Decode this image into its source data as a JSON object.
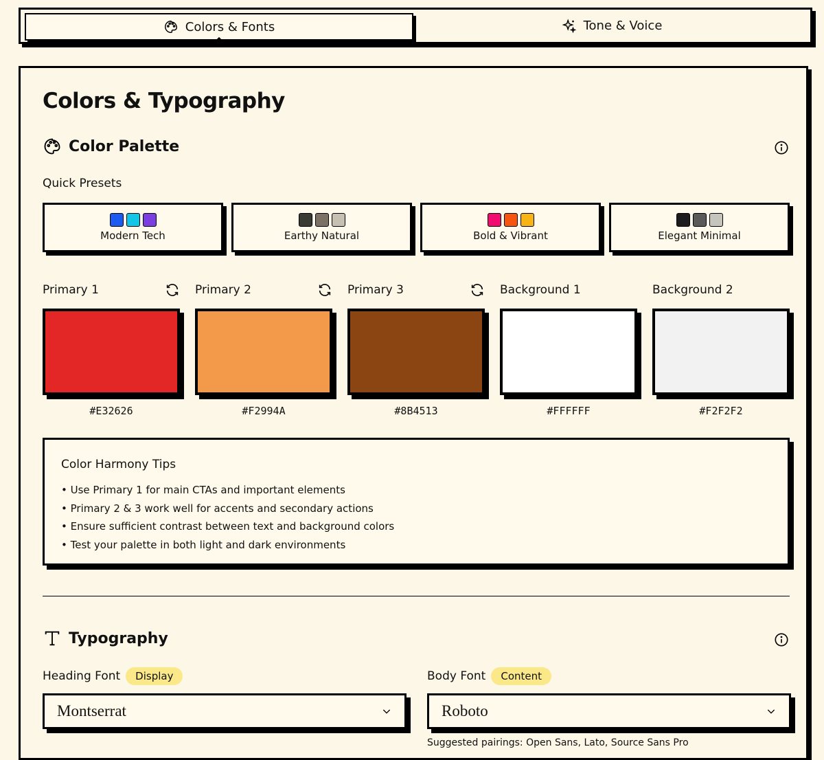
{
  "tabs": [
    {
      "label": "Colors & Fonts",
      "icon": "palette-icon",
      "active": true
    },
    {
      "label": "Tone & Voice",
      "icon": "sparkle-icon",
      "active": false
    }
  ],
  "page_title": "Colors & Typography",
  "palette": {
    "heading": "Color Palette",
    "presets_label": "Quick Presets",
    "presets": [
      {
        "name": "Modern Tech",
        "colors": [
          "#1d5bf0",
          "#12c6e8",
          "#7b3fe0"
        ]
      },
      {
        "name": "Earthy Natural",
        "colors": [
          "#3a3a34",
          "#7d7166",
          "#c6c0b2"
        ]
      },
      {
        "name": "Bold & Vibrant",
        "colors": [
          "#f20c71",
          "#f7540f",
          "#f7b515"
        ]
      },
      {
        "name": "Elegant Minimal",
        "colors": [
          "#1c1c1c",
          "#5a5a5a",
          "#c5c5bd"
        ]
      }
    ],
    "swatches": [
      {
        "label": "Primary 1",
        "hex": "#E32626",
        "refresh": true
      },
      {
        "label": "Primary 2",
        "hex": "#F2994A",
        "refresh": true
      },
      {
        "label": "Primary 3",
        "hex": "#8B4513",
        "refresh": true
      },
      {
        "label": "Background 1",
        "hex": "#FFFFFF",
        "refresh": false
      },
      {
        "label": "Background 2",
        "hex": "#F2F2F2",
        "refresh": false
      }
    ],
    "tips": {
      "title": "Color Harmony Tips",
      "items": [
        "• Use Primary 1 for main CTAs and important elements",
        "• Primary 2 & 3 work well for accents and secondary actions",
        "• Ensure sufficient contrast between text and background colors",
        "• Test your palette in both light and dark environments"
      ]
    }
  },
  "typography": {
    "heading": "Typography",
    "heading_font": {
      "label": "Heading Font",
      "badge": "Display",
      "value": "Montserrat"
    },
    "body_font": {
      "label": "Body Font",
      "badge": "Content",
      "value": "Roboto"
    },
    "pairings": "Suggested pairings: Open Sans, Lato, Source Sans Pro"
  },
  "colors": {
    "background": "#fdf7e7",
    "badge": "#fbe989",
    "border": "#000000"
  }
}
